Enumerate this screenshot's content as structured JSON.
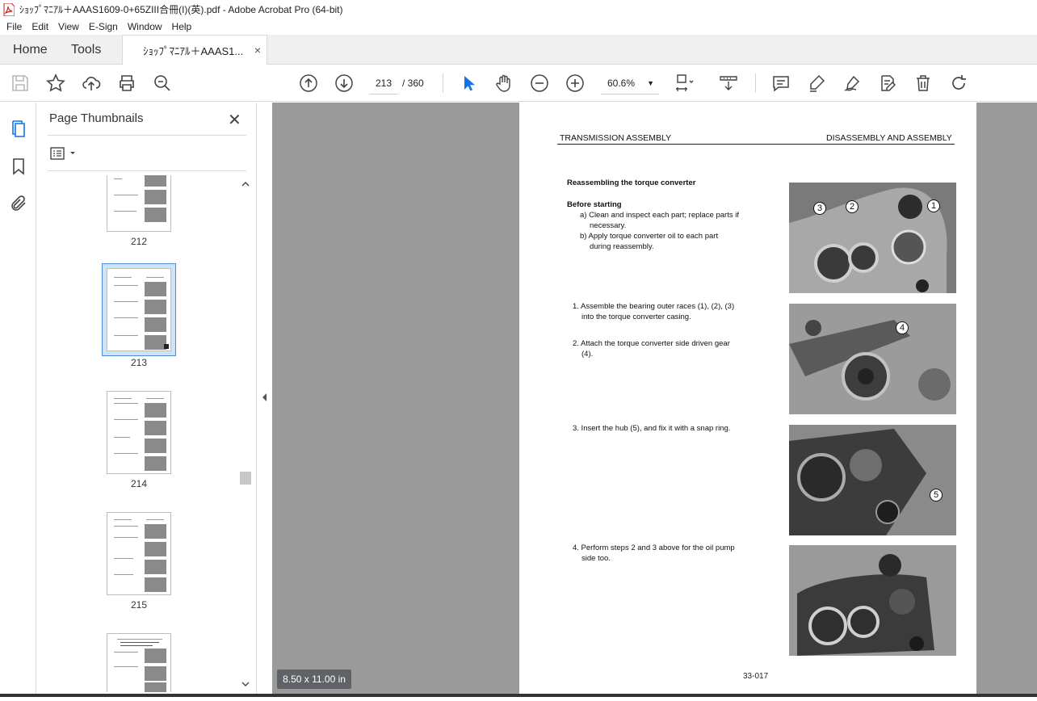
{
  "window": {
    "title": "ｼｮｯﾌﾟﾏﾆｱﾙ＋AAAS1609-0+65ZIII合冊(I)(英).pdf - Adobe Acrobat Pro (64-bit)"
  },
  "menu": [
    "File",
    "Edit",
    "View",
    "E-Sign",
    "Window",
    "Help"
  ],
  "tabs": {
    "home": "Home",
    "tools": "Tools",
    "document": "ｼｮｯﾌﾟﾏﾆｱﾙ＋AAAS1...",
    "close": "×"
  },
  "toolbar": {
    "current_page": "213",
    "total_pages": "/ 360",
    "zoom": "60.6%"
  },
  "panel": {
    "title": "Page Thumbnails",
    "thumbnails": [
      {
        "label": "212"
      },
      {
        "label": "213",
        "selected": true
      },
      {
        "label": "214"
      },
      {
        "label": "215"
      },
      {
        "label": ""
      }
    ]
  },
  "document_page": {
    "header_left": "TRANSMISSION ASSEMBLY",
    "header_right": "DISASSEMBLY AND ASSEMBLY",
    "section_title": "Reassembling the torque converter",
    "before_starting": "Before starting",
    "before_a": "a) Clean and inspect each part; replace parts if",
    "before_a2": "necessary.",
    "before_b": "b) Apply torque converter oil to each part",
    "before_b2": "during reassembly.",
    "step1": "1. Assemble the bearing outer races (1), (2), (3)",
    "step1b": "into the torque converter casing.",
    "step2": "2. Attach the torque converter side driven gear",
    "step2b": "(4).",
    "step3": "3. Insert the hub (5), and fix it with a snap ring.",
    "step4": "4. Perform steps 2 and 3 above for the oil pump",
    "step4b": "side too.",
    "callouts": [
      "3",
      "2",
      "1",
      "4",
      "5"
    ],
    "page_number": "33-017"
  },
  "status": {
    "page_size": "8.50 x 11.00 in"
  }
}
